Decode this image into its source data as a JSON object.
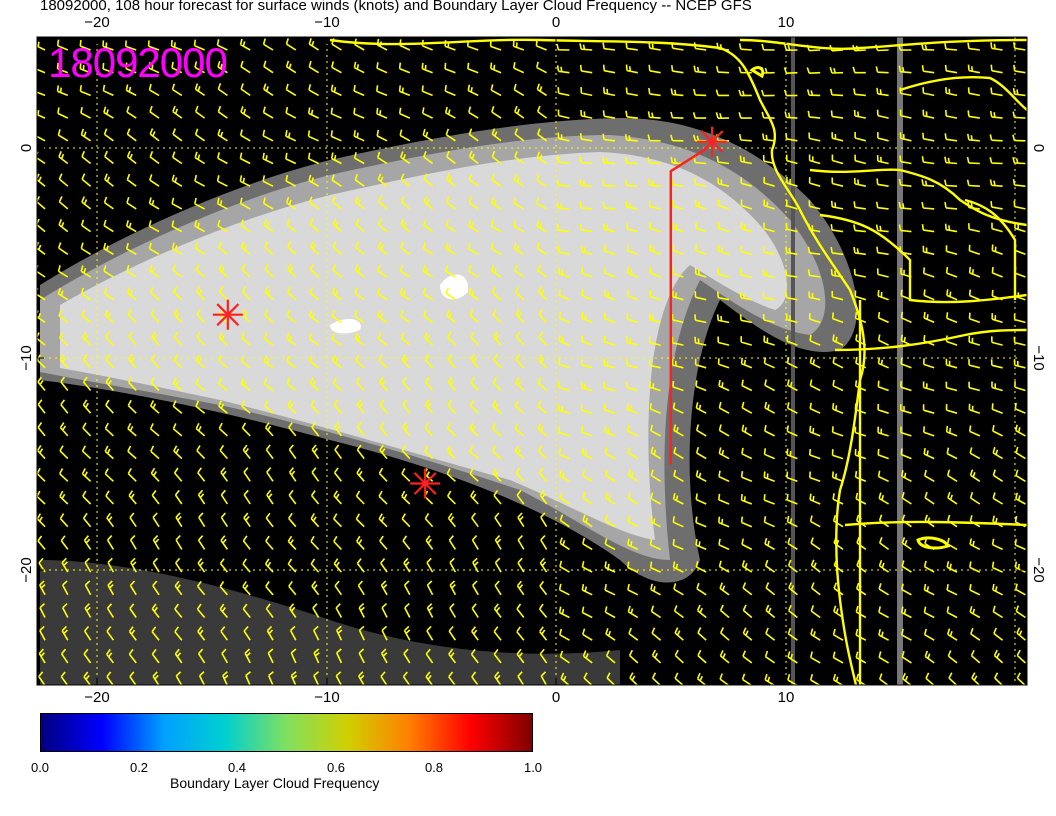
{
  "title": "18092000, 108 hour forecast for surface winds (knots) and Boundary Layer Cloud Frequency -- NCEP GFS",
  "stamp": "18092000",
  "axes": {
    "x_ticks": [
      "−20",
      "−10",
      "0",
      "10"
    ],
    "y_ticks": [
      "0",
      "−10",
      "−20"
    ]
  },
  "colorbar": {
    "title": "Boundary Layer Cloud Frequency",
    "ticks": [
      "0.0",
      "0.2",
      "0.4",
      "0.6",
      "0.8",
      "1.0"
    ],
    "colors": [
      "#00007f",
      "#0000ff",
      "#00a0ff",
      "#00d0d0",
      "#80e060",
      "#d0d000",
      "#ff8000",
      "#ff0000",
      "#800000"
    ]
  },
  "colors": {
    "background": "#000000",
    "cloud_light": "#d9d9d9",
    "cloud_mid": "#a6a6a6",
    "cloud_dark": "#6e6e6e",
    "coast": "#ffff00",
    "barbs": "#ffff00",
    "markers": "#ff0000",
    "stamp": "#ff00ff"
  },
  "markers": [
    {
      "name": "marker-west",
      "lon": -14.3,
      "lat": -7.9
    },
    {
      "name": "marker-south",
      "lon": -5.7,
      "lat": -15.9
    },
    {
      "name": "marker-northeast",
      "lon": 6.8,
      "lat": 0.3
    }
  ],
  "flight_track": [
    [
      5.0,
      -15.0
    ],
    [
      5.0,
      -1.1
    ],
    [
      6.6,
      0.0
    ]
  ]
}
